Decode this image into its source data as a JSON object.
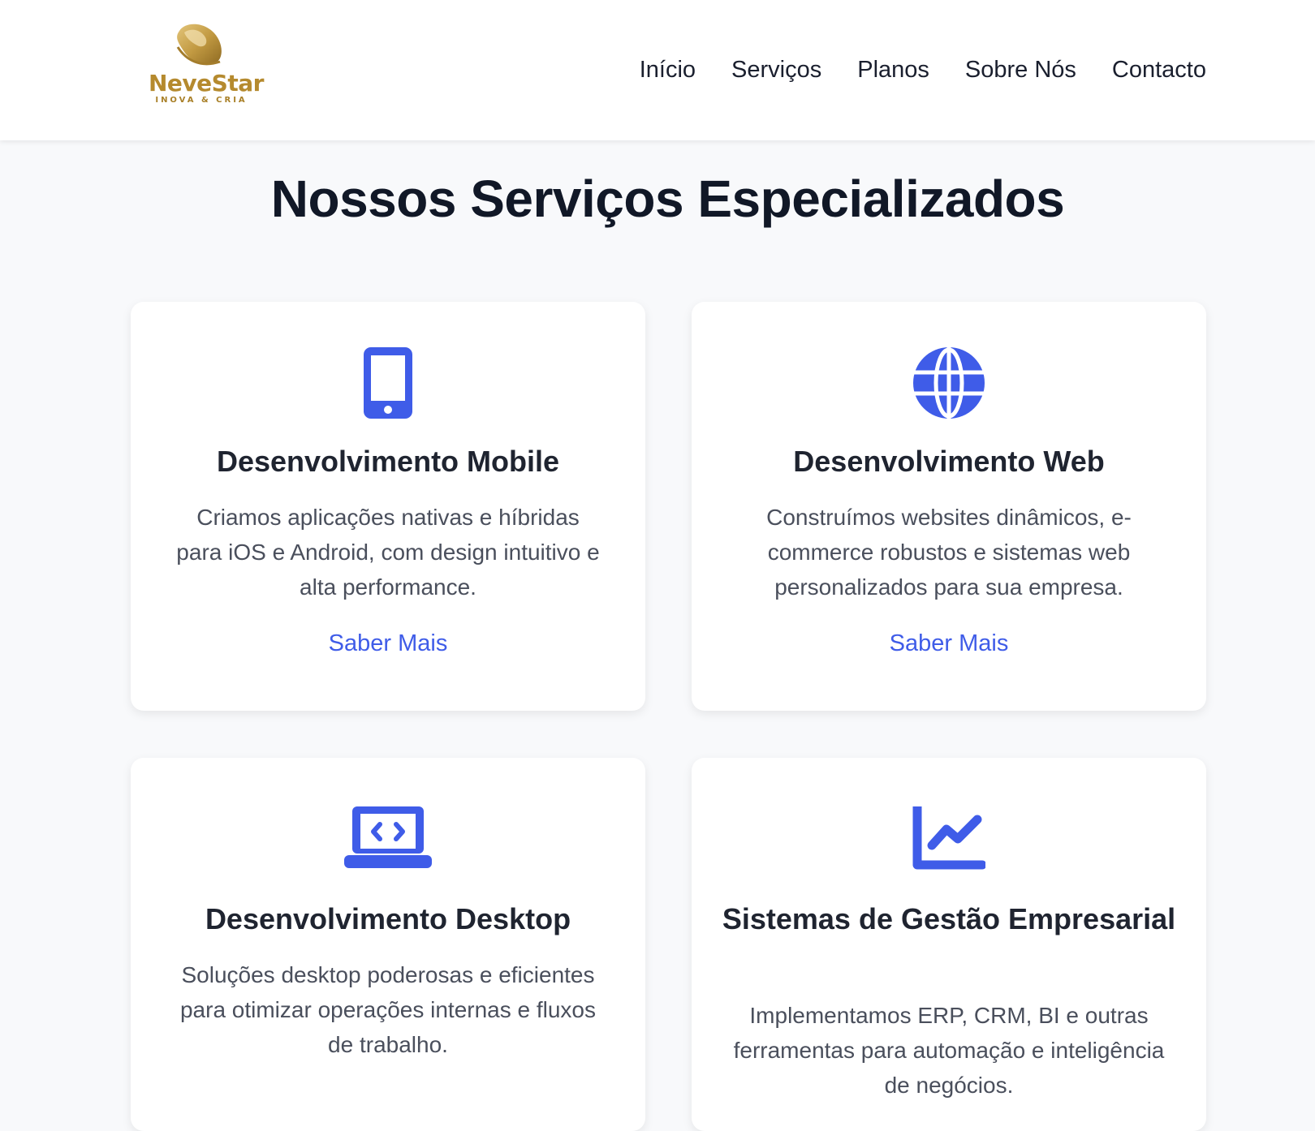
{
  "header": {
    "logo": {
      "name": "NeveStar",
      "tagline": "INOVA & CRIA"
    },
    "nav": [
      {
        "label": "Início"
      },
      {
        "label": "Serviços"
      },
      {
        "label": "Planos"
      },
      {
        "label": "Sobre Nós"
      },
      {
        "label": "Contacto"
      }
    ]
  },
  "colors": {
    "accent": "#3f5ce8",
    "brand_gold": "#b58a2e",
    "background": "#f8f9fb"
  },
  "section": {
    "title": "Nossos Serviços Especializados",
    "cards": [
      {
        "icon": "mobile-phone-icon",
        "title": "Desenvolvimento Mobile",
        "description": "Criamos aplicações nativas e híbridas para iOS e Android, com design intuitivo e alta performance.",
        "link": "Saber Mais"
      },
      {
        "icon": "globe-icon",
        "title": "Desenvolvimento Web",
        "description": "Construímos websites dinâmicos, e-commerce robustos e sistemas web personalizados para sua empresa.",
        "link": "Saber Mais"
      },
      {
        "icon": "laptop-code-icon",
        "title": "Desenvolvimento Desktop",
        "description": "Soluções desktop poderosas e eficientes para otimizar operações internas e fluxos de trabalho."
      },
      {
        "icon": "chart-line-icon",
        "title": "Sistemas de Gestão Empresarial",
        "description": "Implementamos ERP, CRM, BI e outras ferramentas para automação e inteligência de negócios."
      }
    ]
  }
}
